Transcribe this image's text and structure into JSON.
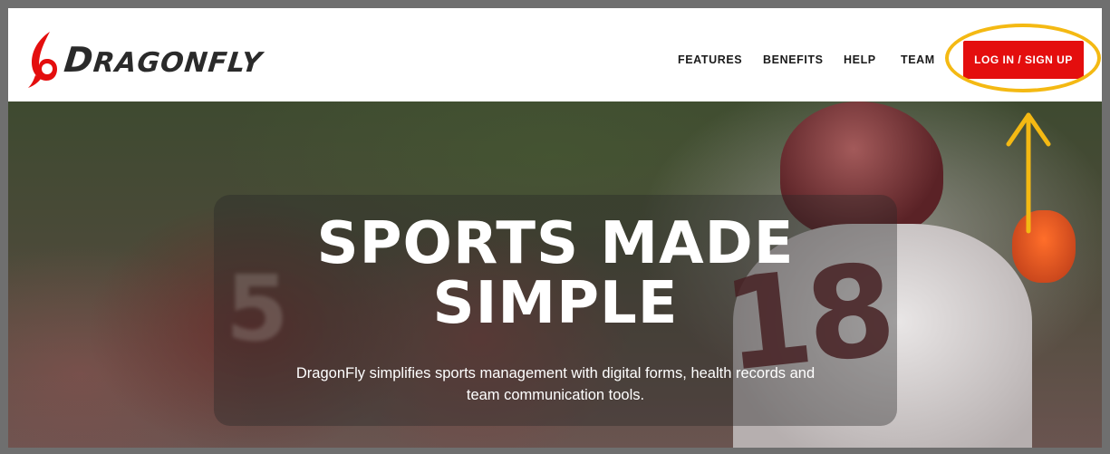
{
  "brand": {
    "name_first": "D",
    "name_rest": "RAGONFLY",
    "accent_color": "#e40e0e"
  },
  "nav": {
    "items": [
      {
        "label": "FEATURES"
      },
      {
        "label": "BENEFITS"
      },
      {
        "label": "HELP"
      },
      {
        "label": "TEAM"
      }
    ],
    "login_label": "LOG IN / SIGN UP"
  },
  "hero": {
    "title_line1": "SPORTS MADE",
    "title_line2": "SIMPLE",
    "subtitle_line1": "DragonFly simplifies sports management with digital forms, health records and",
    "subtitle_line2": "team communication tools.",
    "jersey_number": "18",
    "background_number": "5"
  },
  "annotation": {
    "highlight_color": "#f4b913",
    "arrow_icon": "arrow-up-icon"
  }
}
